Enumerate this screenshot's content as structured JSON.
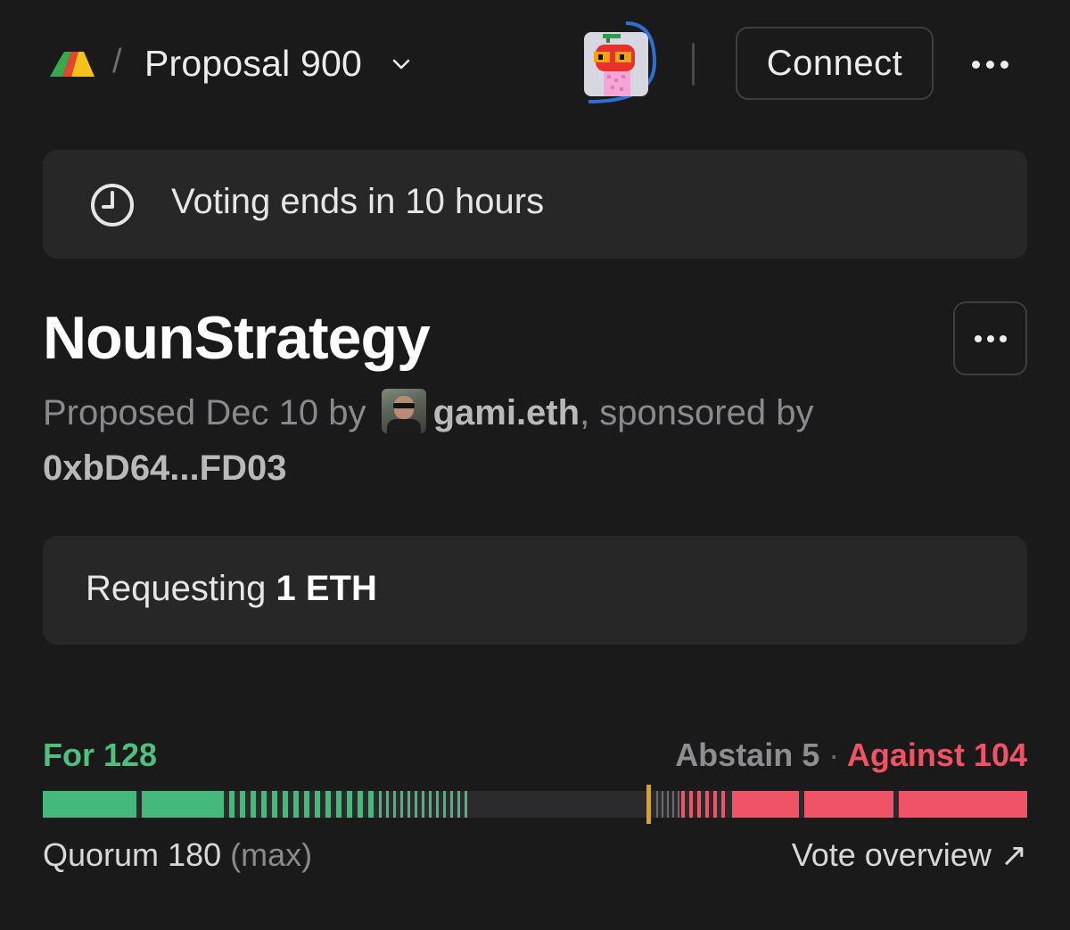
{
  "header": {
    "breadcrumb_separator": "/",
    "proposal_label": "Proposal 900",
    "connect_label": "Connect",
    "icons": [
      "nouns-logo-icon",
      "chevron-down-icon",
      "noun-avatar-icon",
      "more-horizontal-icon"
    ]
  },
  "status": {
    "text": "Voting ends in 10 hours",
    "icon": "clock-icon"
  },
  "proposal": {
    "title": "NounStrategy",
    "byline_prefix": "Proposed Dec 10 by",
    "proposer": "gami.eth",
    "byline_middle": ", sponsored by",
    "sponsor": "0xbD64...FD03"
  },
  "request": {
    "prefix": "Requesting",
    "amount": "1 ETH"
  },
  "votes": {
    "for_label": "For 128",
    "abstain_label": "Abstain 5",
    "separator": "·",
    "against_label": "Against 104",
    "for": 128,
    "abstain": 5,
    "against": 104,
    "quorum_label": "Quorum 180",
    "quorum_suffix": "(max)",
    "overview_label": "Vote overview ↗"
  },
  "colors": {
    "for": "#45b97c",
    "against": "#ef5365",
    "abstain": "#6a6a6e",
    "quorum_marker": "#e0a117",
    "background": "#1a1a1b",
    "card": "#272728"
  }
}
